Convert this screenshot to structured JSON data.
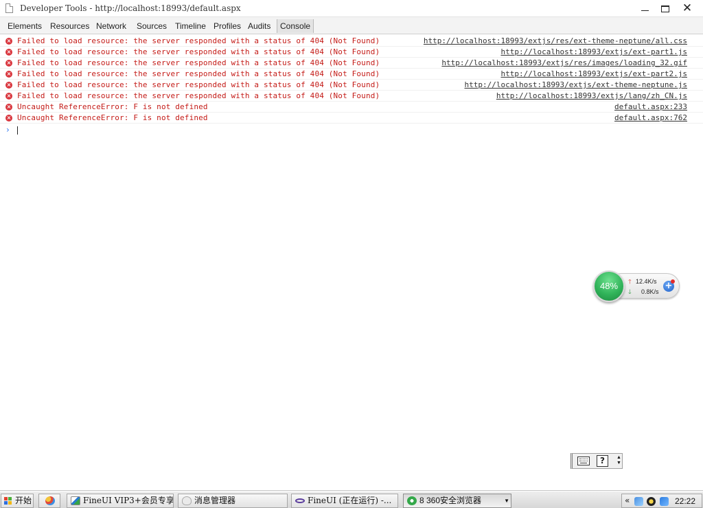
{
  "window": {
    "title": "Developer Tools - http://localhost:18993/default.aspx",
    "controls": {
      "minimize": "minimize",
      "maximize": "maximize",
      "close": "✕"
    }
  },
  "tabs": [
    "Elements",
    "Resources",
    "Network",
    "Sources",
    "Timeline",
    "Profiles",
    "Audits",
    "Console"
  ],
  "active_tab": "Console",
  "console": {
    "messages": [
      {
        "level": "error",
        "text": "Failed to load resource: the server responded with a status of 404 (Not Found)",
        "source": "http://localhost:18993/extjs/res/ext-theme-neptune/all.css"
      },
      {
        "level": "error",
        "text": "Failed to load resource: the server responded with a status of 404 (Not Found)",
        "source": "http://localhost:18993/extjs/ext-part1.js"
      },
      {
        "level": "error",
        "text": "Failed to load resource: the server responded with a status of 404 (Not Found)",
        "source": "http://localhost:18993/extjs/res/images/loading_32.gif"
      },
      {
        "level": "error",
        "text": "Failed to load resource: the server responded with a status of 404 (Not Found)",
        "source": "http://localhost:18993/extjs/ext-part2.js"
      },
      {
        "level": "error",
        "text": "Failed to load resource: the server responded with a status of 404 (Not Found)",
        "source": "http://localhost:18993/extjs/ext-theme-neptune.js"
      },
      {
        "level": "error",
        "text": "Failed to load resource: the server responded with a status of 404 (Not Found)",
        "source": "http://localhost:18993/extjs/lang/zh_CN.js"
      },
      {
        "level": "error",
        "text": "Uncaught ReferenceError: F is not defined",
        "source": "default.aspx:233"
      },
      {
        "level": "error",
        "text": "Uncaught ReferenceError: F is not defined",
        "source": "default.aspx:762"
      }
    ],
    "prompt_symbol": "›",
    "input_value": ""
  },
  "net_monitor": {
    "percent": "48%",
    "upload": "12.4K/s",
    "download": "0.8K/s",
    "up_arrow": "🡑",
    "down_arrow": "🡓",
    "plus": "+"
  },
  "ime_toolbar": {
    "help": "?",
    "menu_up": "▲",
    "menu_down": "▼"
  },
  "taskbar": {
    "start_label": "开始",
    "tasks": [
      {
        "label": "FineUI VIP3+会员专享",
        "icon": "chart-icon"
      },
      {
        "label": "消息管理器",
        "icon": "qq-icon"
      },
      {
        "label": "FineUI (正在运行) -...",
        "icon": "visual-studio-icon"
      },
      {
        "label": "8 360安全浏览器",
        "icon": "browser-360-icon",
        "active": true
      }
    ],
    "tray_chevron": "«",
    "clock": "22:22"
  },
  "colors": {
    "error_text": "#c41a16",
    "error_icon": "#d9363e",
    "prompt": "#367cf1",
    "netmon_ball": "#31b45a"
  }
}
